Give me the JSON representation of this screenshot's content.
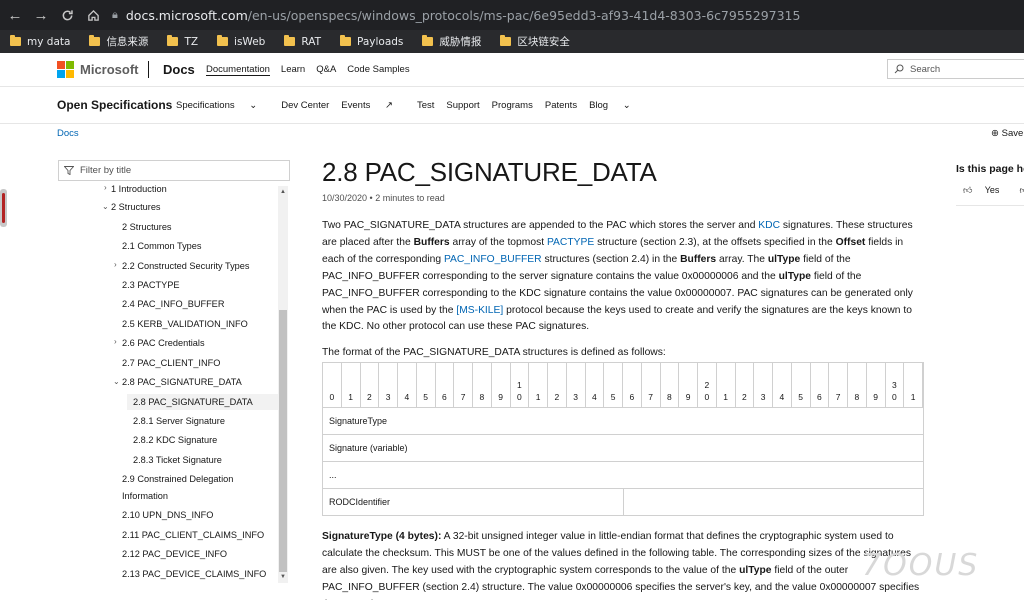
{
  "browser": {
    "url_host": "docs.microsoft.com",
    "url_path": "/en-us/openspecs/windows_protocols/ms-pac/6e95edd3-af93-41d4-8303-6c7955297315",
    "bookmarks": [
      "my data",
      "信息来源",
      "TZ",
      "isWeb",
      "RAT",
      "Payloads",
      "威胁情报",
      "区块链安全"
    ]
  },
  "header": {
    "brand": "Microsoft",
    "product": "Docs",
    "nav": [
      "Documentation",
      "Learn",
      "Q&A",
      "Code Samples"
    ],
    "search_placeholder": "Search"
  },
  "subheader": {
    "title": "Open Specifications",
    "nav": [
      "Specifications",
      "Dev Center",
      "Events",
      "Test",
      "Support",
      "Programs",
      "Patents",
      "Blog"
    ]
  },
  "breadcrumb": "Docs",
  "save_label": "Save",
  "toc": {
    "filter_placeholder": "Filter by title",
    "items": [
      "1 Introduction",
      "2 Structures",
      "2 Structures",
      "2.1 Common Types",
      "2.2 Constructed Security Types",
      "2.3 PACTYPE",
      "2.4 PAC_INFO_BUFFER",
      "2.5 KERB_VALIDATION_INFO",
      "2.6 PAC Credentials",
      "2.7 PAC_CLIENT_INFO",
      "2.8 PAC_SIGNATURE_DATA",
      "2.8 PAC_SIGNATURE_DATA",
      "2.8.1 Server Signature",
      "2.8.2 KDC Signature",
      "2.8.3 Ticket Signature",
      "2.9 Constrained Delegation",
      "Information",
      "2.10 UPN_DNS_INFO",
      "2.11 PAC_CLIENT_CLAIMS_INFO",
      "2.12 PAC_DEVICE_INFO",
      "2.13 PAC_DEVICE_CLAIMS_INFO"
    ]
  },
  "article": {
    "title": "2.8 PAC_SIGNATURE_DATA",
    "date": "10/30/2020",
    "read_time": "2 minutes to read",
    "p1": {
      "a": "Two PAC_SIGNATURE_DATA structures are appended to the PAC which stores the server and ",
      "kdc": "KDC",
      "b": " signatures. These structures are placed after the ",
      "buffers": "Buffers",
      "c": " array of the topmost ",
      "pactype": "PACTYPE",
      "d": " structure (section 2.3), at the offsets specified in the ",
      "offset": "Offset",
      "e": " fields in each of the corresponding ",
      "pacinfo": "PAC_INFO_BUFFER",
      "f": " structures (section 2.4) in the ",
      "buffers2": "Buffers",
      "g": " array. The ",
      "ultype": "ulType",
      "h": " field of the PAC_INFO_BUFFER corresponding to the server signature contains the value 0x00000006 and the ",
      "ultype2": "ulType",
      "i": " field of the PAC_INFO_BUFFER corresponding to the KDC signature contains the value 0x00000007. PAC signatures can be generated only when the PAC is used by the ",
      "mskile": "[MS-KILE]",
      "j": " protocol because the keys used to create and verify the signatures are the keys known to the KDC. No other protocol can use these PAC signatures."
    },
    "p2": "The format of the PAC_SIGNATURE_DATA structures is defined as follows:",
    "bits": [
      "0",
      "1",
      "2",
      "3",
      "4",
      "5",
      "6",
      "7",
      "8",
      "9",
      "1\n0",
      "1",
      "2",
      "3",
      "4",
      "5",
      "6",
      "7",
      "8",
      "9",
      "2\n0",
      "1",
      "2",
      "3",
      "4",
      "5",
      "6",
      "7",
      "8",
      "9",
      "3\n0",
      "1"
    ],
    "rows": [
      "SignatureType",
      "Signature (variable)",
      "...",
      "RODCIdentifier"
    ],
    "p3": {
      "term": "SignatureType (4 bytes):",
      "a": " A 32-bit unsigned integer value in little-endian format that defines the cryptographic system used to calculate the checksum. This MUST be one of the values defined in the following table. The corresponding sizes of the signatures are also given. The key used with the cryptographic system corresponds to the value of the ",
      "ultype": "ulType",
      "b": " field of the outer PAC_INFO_BUFFER (section 2.4) structure. The value 0x00000006 specifies the server's key, and the value 0x00000007 specifies the KDC's key."
    }
  },
  "rail": {
    "question": "Is this page helpful?",
    "yes": "Yes",
    "no": "No"
  },
  "watermark": "7OOUS",
  "colors": {
    "link": "#0065b3",
    "ms_red": "#f25022",
    "ms_green": "#7fba00",
    "ms_blue": "#00a4ef",
    "ms_yellow": "#ffb900"
  }
}
